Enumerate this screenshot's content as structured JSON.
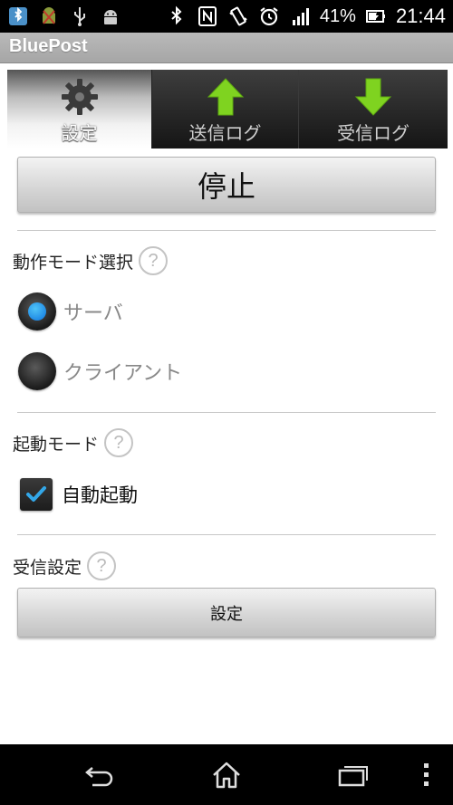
{
  "status_bar": {
    "icons_left": [
      "bluetooth-app-icon",
      "android-debug-icon",
      "usb-icon",
      "android-icon"
    ],
    "icons_right": [
      "bluetooth-icon",
      "nfc-icon",
      "vibrate-icon",
      "alarm-icon",
      "signal-icon"
    ],
    "battery": "41%",
    "time": "21:44"
  },
  "app": {
    "title": "BluePost"
  },
  "tabs": [
    {
      "label": "設定",
      "icon": "gear-icon",
      "active": true
    },
    {
      "label": "送信ログ",
      "icon": "arrow-up-icon",
      "active": false
    },
    {
      "label": "受信ログ",
      "icon": "arrow-down-icon",
      "active": false
    }
  ],
  "main": {
    "stop_button": "停止",
    "mode_section": {
      "label": "動作モード選択",
      "help": "?",
      "options": [
        {
          "label": "サーバ",
          "selected": true
        },
        {
          "label": "クライアント",
          "selected": false
        }
      ]
    },
    "boot_section": {
      "label": "起動モード",
      "help": "?",
      "checkbox": {
        "label": "自動起動",
        "checked": true
      }
    },
    "receive_section": {
      "label": "受信設定",
      "help": "?",
      "button": "設定"
    }
  },
  "colors": {
    "accent": "#1e88e5",
    "tab_green": "#7fd320"
  },
  "nav": [
    "back-icon",
    "home-icon",
    "recent-apps-icon",
    "overflow-menu-icon"
  ]
}
